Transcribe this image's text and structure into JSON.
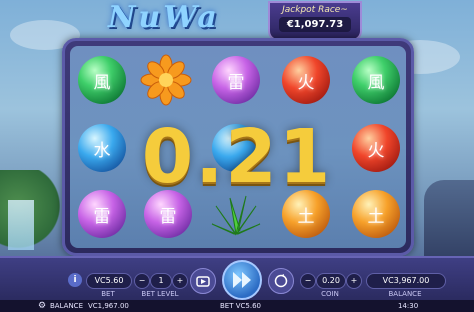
{
  "game": {
    "logo_text": "NuWa",
    "jackpot_title": "Jackpot Race~",
    "jackpot_value": "€1,097.73",
    "win_amount": "0.21"
  },
  "symbols": {
    "glyph_wind": "風",
    "glyph_thunder": "雷",
    "glyph_fire": "火",
    "glyph_water": "水",
    "glyph_earth": "土"
  },
  "controls": {
    "bet_value": "VC5.60",
    "bet_label": "BET",
    "bet_level_value": "1",
    "bet_level_label": "BET LEVEL",
    "coin_value": "0.20",
    "coin_label": "COIN",
    "balance_value": "VC3,967.00",
    "balance_label": "BALANCE",
    "minus_symbol": "−",
    "plus_symbol": "+",
    "info_symbol": "i"
  },
  "statusbar": {
    "balance_label": "BALANCE",
    "balance_value": "VC1,967.00",
    "bet_text": "BET VC5.60",
    "clock": "14:30"
  },
  "icons": [
    "info-icon",
    "autoplay-icon",
    "spin-icon",
    "turbo-icon",
    "settings-icon",
    "minus-icon",
    "plus-icon"
  ],
  "colors": {
    "accent": "#f5cc3c",
    "frame": "#3f3a7a",
    "panel": "#2a2a5e"
  }
}
